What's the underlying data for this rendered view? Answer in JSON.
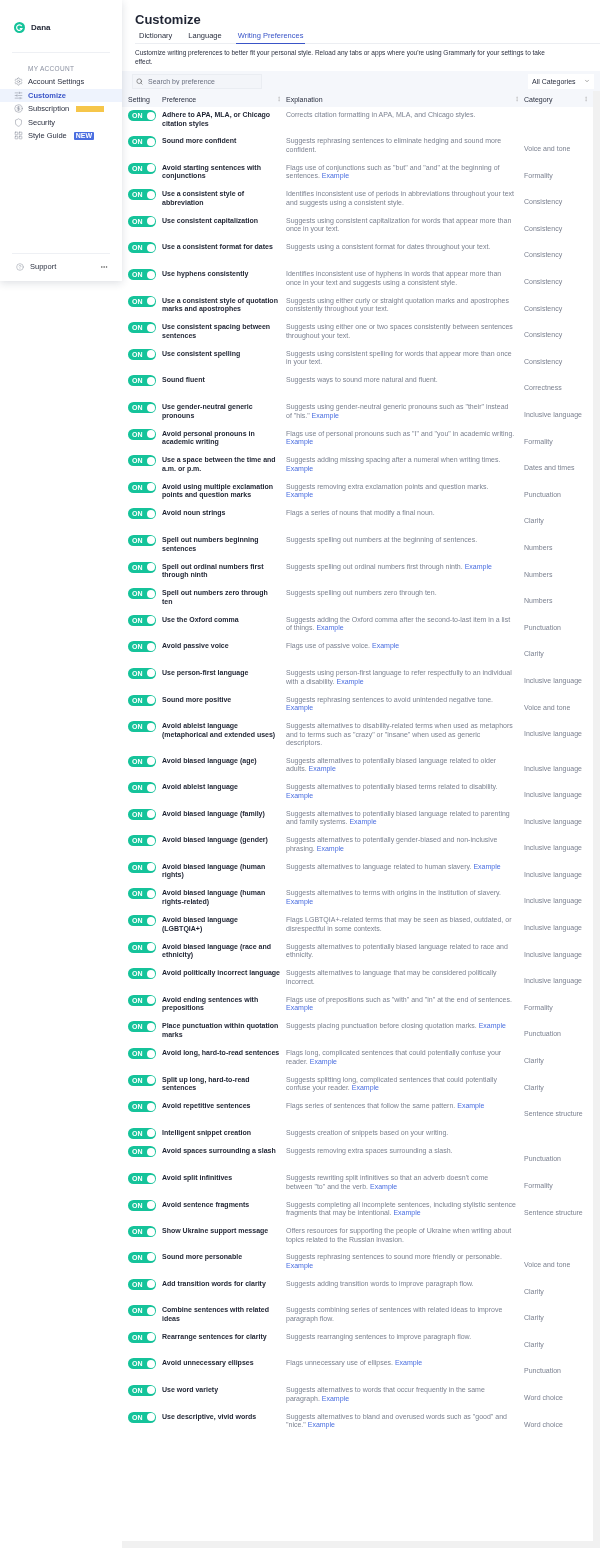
{
  "sidebar": {
    "user": "Dana",
    "section_label": "MY ACCOUNT",
    "items": [
      {
        "label": "Account Settings",
        "selected": false
      },
      {
        "label": "Customize",
        "selected": true
      },
      {
        "label": "Subscription",
        "selected": false,
        "badge": {
          "kind": "blurred"
        }
      },
      {
        "label": "Security",
        "selected": false
      },
      {
        "label": "Style Guide",
        "selected": false,
        "badge": {
          "kind": "text",
          "text": "NEW"
        }
      }
    ],
    "footer": {
      "label": "Support"
    }
  },
  "page": {
    "title": "Customize",
    "tabs": [
      {
        "label": "Dictionary",
        "selected": false
      },
      {
        "label": "Language",
        "selected": false
      },
      {
        "label": "Writing Preferences",
        "selected": true
      }
    ],
    "description": "Customize writing preferences to better fit your personal style. Reload any tabs or apps where you're using Grammarly for your settings to take effect."
  },
  "toolbar": {
    "search": {
      "placeholder": "Search by preference"
    },
    "filter": {
      "value": "All Categories"
    }
  },
  "table": {
    "columns": [
      "Setting",
      "Preference",
      "Explanation",
      "Category"
    ],
    "rows": [
      {
        "on": true,
        "switch_label": "ON",
        "preference": "Adhere to APA, MLA, or Chicago citation styles",
        "explanation": "Corrects citation formatting in APA, MLA, and Chicago styles."
      },
      {
        "on": true,
        "switch_label": "ON",
        "preference": "Sound more confident",
        "explanation": "Suggests rephrasing sentences to eliminate hedging and sound more confident.",
        "category": "Voice and tone"
      },
      {
        "on": true,
        "switch_label": "ON",
        "preference": "Avoid starting sentences with conjunctions",
        "explanation": "Flags use of conjunctions such as \"but\" and \"and\" at the beginning of sentences.",
        "link": "Example",
        "category": "Formality"
      },
      {
        "on": true,
        "switch_label": "ON",
        "preference": "Use a consistent style of abbreviation",
        "explanation": "Identifies inconsistent use of periods in abbreviations throughout your text and suggests using a consistent style.",
        "category": "Consistency"
      },
      {
        "on": true,
        "switch_label": "ON",
        "preference": "Use consistent capitalization",
        "explanation": "Suggests using consistent capitalization for words that appear more than once in your text.",
        "category": "Consistency"
      },
      {
        "on": true,
        "switch_label": "ON",
        "preference": "Use a consistent format for dates",
        "explanation": "Suggests using a consistent format for dates throughout your text.",
        "category": "Consistency"
      },
      {
        "on": true,
        "switch_label": "ON",
        "preference": "Use hyphens consistently",
        "explanation": "Identifies inconsistent use of hyphens in words that appear more than once in your text and suggests using a consistent style.",
        "category": "Consistency"
      },
      {
        "on": true,
        "switch_label": "ON",
        "preference": "Use a consistent style of quotation marks and apostrophes",
        "explanation": "Suggests using either curly or straight quotation marks and apostrophes consistently throughout your text.",
        "category": "Consistency"
      },
      {
        "on": true,
        "switch_label": "ON",
        "preference": "Use consistent spacing between sentences",
        "explanation": "Suggests using either one or two spaces consistently between sentences throughout your text.",
        "category": "Consistency"
      },
      {
        "on": true,
        "switch_label": "ON",
        "preference": "Use consistent spelling",
        "explanation": "Suggests using consistent spelling for words that appear more than once in your text.",
        "category": "Consistency"
      },
      {
        "on": true,
        "switch_label": "ON",
        "preference": "Sound fluent",
        "explanation": "Suggests ways to sound more natural and fluent.",
        "category": "Correctness"
      },
      {
        "on": true,
        "switch_label": "ON",
        "preference": "Use gender-neutral generic pronouns",
        "explanation": "Suggests using gender-neutral generic pronouns such as \"their\" instead of \"his.\"",
        "link": "Example",
        "category": "Inclusive language"
      },
      {
        "on": true,
        "switch_label": "ON",
        "preference": "Avoid personal pronouns in academic writing",
        "explanation": "Flags use of personal pronouns such as \"I\" and \"you\" in academic writing.",
        "link": "Example",
        "category": "Formality"
      },
      {
        "on": true,
        "switch_label": "ON",
        "preference": "Use a space between the time and a.m. or p.m.",
        "explanation": "Suggests adding missing spacing after a numeral when writing times.",
        "link": "Example",
        "category": "Dates and times"
      },
      {
        "on": true,
        "switch_label": "ON",
        "preference": "Avoid using multiple exclamation points and question marks",
        "explanation": "Suggests removing extra exclamation points and question marks.",
        "link": "Example",
        "category": "Punctuation"
      },
      {
        "on": true,
        "switch_label": "ON",
        "preference": "Avoid noun strings",
        "explanation": "Flags a series of nouns that modify a final noun.",
        "category": "Clarity"
      },
      {
        "on": true,
        "switch_label": "ON",
        "preference": "Spell out numbers beginning sentences",
        "explanation": "Suggests spelling out numbers at the beginning of sentences.",
        "category": "Numbers"
      },
      {
        "on": true,
        "switch_label": "ON",
        "preference": "Spell out ordinal numbers first through ninth",
        "explanation": "Suggests spelling out ordinal numbers first through ninth.",
        "link": "Example",
        "category": "Numbers"
      },
      {
        "on": true,
        "switch_label": "ON",
        "preference": "Spell out numbers zero through ten",
        "explanation": "Suggests spelling out numbers zero through ten.",
        "category": "Numbers"
      },
      {
        "on": true,
        "switch_label": "ON",
        "preference": "Use the Oxford comma",
        "explanation": "Suggests adding the Oxford comma after the second-to-last item in a list of things.",
        "link": "Example",
        "category": "Punctuation"
      },
      {
        "on": true,
        "switch_label": "ON",
        "preference": "Avoid passive voice",
        "explanation": "Flags use of passive voice.",
        "link": "Example",
        "category": "Clarity"
      },
      {
        "on": true,
        "switch_label": "ON",
        "preference": "Use person-first language",
        "explanation": "Suggests using person-first language to refer respectfully to an individual with a disability.",
        "link": "Example",
        "category": "Inclusive language"
      },
      {
        "on": true,
        "switch_label": "ON",
        "preference": "Sound more positive",
        "explanation": "Suggests rephrasing sentences to avoid unintended negative tone.",
        "link": "Example",
        "category": "Voice and tone"
      },
      {
        "on": true,
        "switch_label": "ON",
        "preference": "Avoid ableist language (metaphorical and extended uses)",
        "explanation": "Suggests alternatives to disability-related terms when used as metaphors and to terms such as \"crazy\" or \"insane\" when used as generic descriptors.",
        "category": "Inclusive language"
      },
      {
        "on": true,
        "switch_label": "ON",
        "preference": "Avoid biased language (age)",
        "explanation": "Suggests alternatives to potentially biased language related to older adults.",
        "link": "Example",
        "category": "Inclusive language"
      },
      {
        "on": true,
        "switch_label": "ON",
        "preference": "Avoid ableist language",
        "explanation": "Suggests alternatives to potentially biased terms related to disability.",
        "link": "Example",
        "category": "Inclusive language"
      },
      {
        "on": true,
        "switch_label": "ON",
        "preference": "Avoid biased language (family)",
        "explanation": "Suggests alternatives to potentially biased language related to parenting and family systems.",
        "link": "Example",
        "category": "Inclusive language"
      },
      {
        "on": true,
        "switch_label": "ON",
        "preference": "Avoid biased language (gender)",
        "explanation": "Suggests alternatives to potentially gender-biased and non-inclusive phrasing.",
        "link": "Example",
        "category": "Inclusive language"
      },
      {
        "on": true,
        "switch_label": "ON",
        "preference": "Avoid biased language (human rights)",
        "explanation": "Suggests alternatives to language related to human slavery.",
        "link": "Example",
        "category": "Inclusive language"
      },
      {
        "on": true,
        "switch_label": "ON",
        "preference": "Avoid biased language (human rights-related)",
        "explanation": "Suggests alternatives to terms with origins in the institution of slavery.",
        "link": "Example",
        "category": "Inclusive language"
      },
      {
        "on": true,
        "switch_label": "ON",
        "preference": "Avoid biased language (LGBTQIA+)",
        "explanation": "Flags LGBTQIA+-related terms that may be seen as biased, outdated, or disrespectful in some contexts.",
        "category": "Inclusive language"
      },
      {
        "on": true,
        "switch_label": "ON",
        "preference": "Avoid biased language (race and ethnicity)",
        "explanation": "Suggests alternatives to potentially biased language related to race and ethnicity.",
        "category": "Inclusive language"
      },
      {
        "on": true,
        "switch_label": "ON",
        "preference": "Avoid politically incorrect language",
        "explanation": "Suggests alternatives to language that may be considered politically incorrect.",
        "category": "Inclusive language"
      },
      {
        "on": true,
        "switch_label": "ON",
        "preference": "Avoid ending sentences with prepositions",
        "explanation": "Flags use of prepositions such as \"with\" and \"in\" at the end of sentences.",
        "link": "Example",
        "category": "Formality"
      },
      {
        "on": true,
        "switch_label": "ON",
        "preference": "Place punctuation within quotation marks",
        "explanation": "Suggests placing punctuation before closing quotation marks.",
        "link": "Example",
        "category": "Punctuation"
      },
      {
        "on": true,
        "switch_label": "ON",
        "preference": "Avoid long, hard-to-read sentences",
        "explanation": "Flags long, complicated sentences that could potentially confuse your reader.",
        "link": "Example",
        "category": "Clarity"
      },
      {
        "on": true,
        "switch_label": "ON",
        "preference": "Split up long, hard-to-read sentences",
        "explanation": "Suggests splitting long, complicated sentences that could potentially confuse your reader.",
        "link": "Example",
        "category": "Clarity"
      },
      {
        "on": true,
        "switch_label": "ON",
        "preference": "Avoid repetitive sentences",
        "explanation": "Flags series of sentences that follow the same pattern.",
        "link": "Example",
        "category": "Sentence structure"
      },
      {
        "on": true,
        "switch_label": "ON",
        "preference": "Intelligent snippet creation",
        "explanation": "Suggests creation of snippets based on your writing."
      },
      {
        "on": true,
        "switch_label": "ON",
        "preference": "Avoid spaces surrounding a slash",
        "explanation": "Suggests removing extra spaces surrounding a slash.",
        "category": "Punctuation"
      },
      {
        "on": true,
        "switch_label": "ON",
        "preference": "Avoid split infinitives",
        "explanation": "Suggests rewriting split infinitives so that an adverb doesn't come between \"to\" and the verb.",
        "link": "Example",
        "category": "Formality"
      },
      {
        "on": true,
        "switch_label": "ON",
        "preference": "Avoid sentence fragments",
        "explanation": "Suggests completing all incomplete sentences, including stylistic sentence fragments that may be intentional.",
        "link": "Example",
        "category": "Sentence structure"
      },
      {
        "on": true,
        "switch_label": "ON",
        "preference": "Show Ukraine support message",
        "explanation": "Offers resources for supporting the people of Ukraine when writing about topics related to the Russian invasion."
      },
      {
        "on": true,
        "switch_label": "ON",
        "preference": "Sound more personable",
        "explanation": "Suggests rephrasing sentences to sound more friendly or personable.",
        "link": "Example",
        "category": "Voice and tone"
      },
      {
        "on": true,
        "switch_label": "ON",
        "preference": "Add transition words for clarity",
        "explanation": "Suggests adding transition words to improve paragraph flow.",
        "category": "Clarity"
      },
      {
        "on": true,
        "switch_label": "ON",
        "preference": "Combine sentences with related ideas",
        "explanation": "Suggests combining series of sentences with related ideas to improve paragraph flow.",
        "category": "Clarity"
      },
      {
        "on": true,
        "switch_label": "ON",
        "preference": "Rearrange sentences for clarity",
        "explanation": "Suggests rearranging sentences to improve paragraph flow.",
        "category": "Clarity"
      },
      {
        "on": true,
        "switch_label": "ON",
        "preference": "Avoid unnecessary ellipses",
        "explanation": "Flags unnecessary use of ellipses.",
        "link": "Example",
        "category": "Punctuation"
      },
      {
        "on": true,
        "switch_label": "ON",
        "preference": "Use word variety",
        "explanation": "Suggests alternatives to words that occur frequently in the same paragraph.",
        "link": "Example",
        "category": "Word choice"
      },
      {
        "on": true,
        "switch_label": "ON",
        "preference": "Use descriptive, vivid words",
        "explanation": "Suggests alternatives to bland and overused words such as \"good\" and \"nice.\"",
        "link": "Example",
        "category": "Word choice"
      }
    ]
  }
}
